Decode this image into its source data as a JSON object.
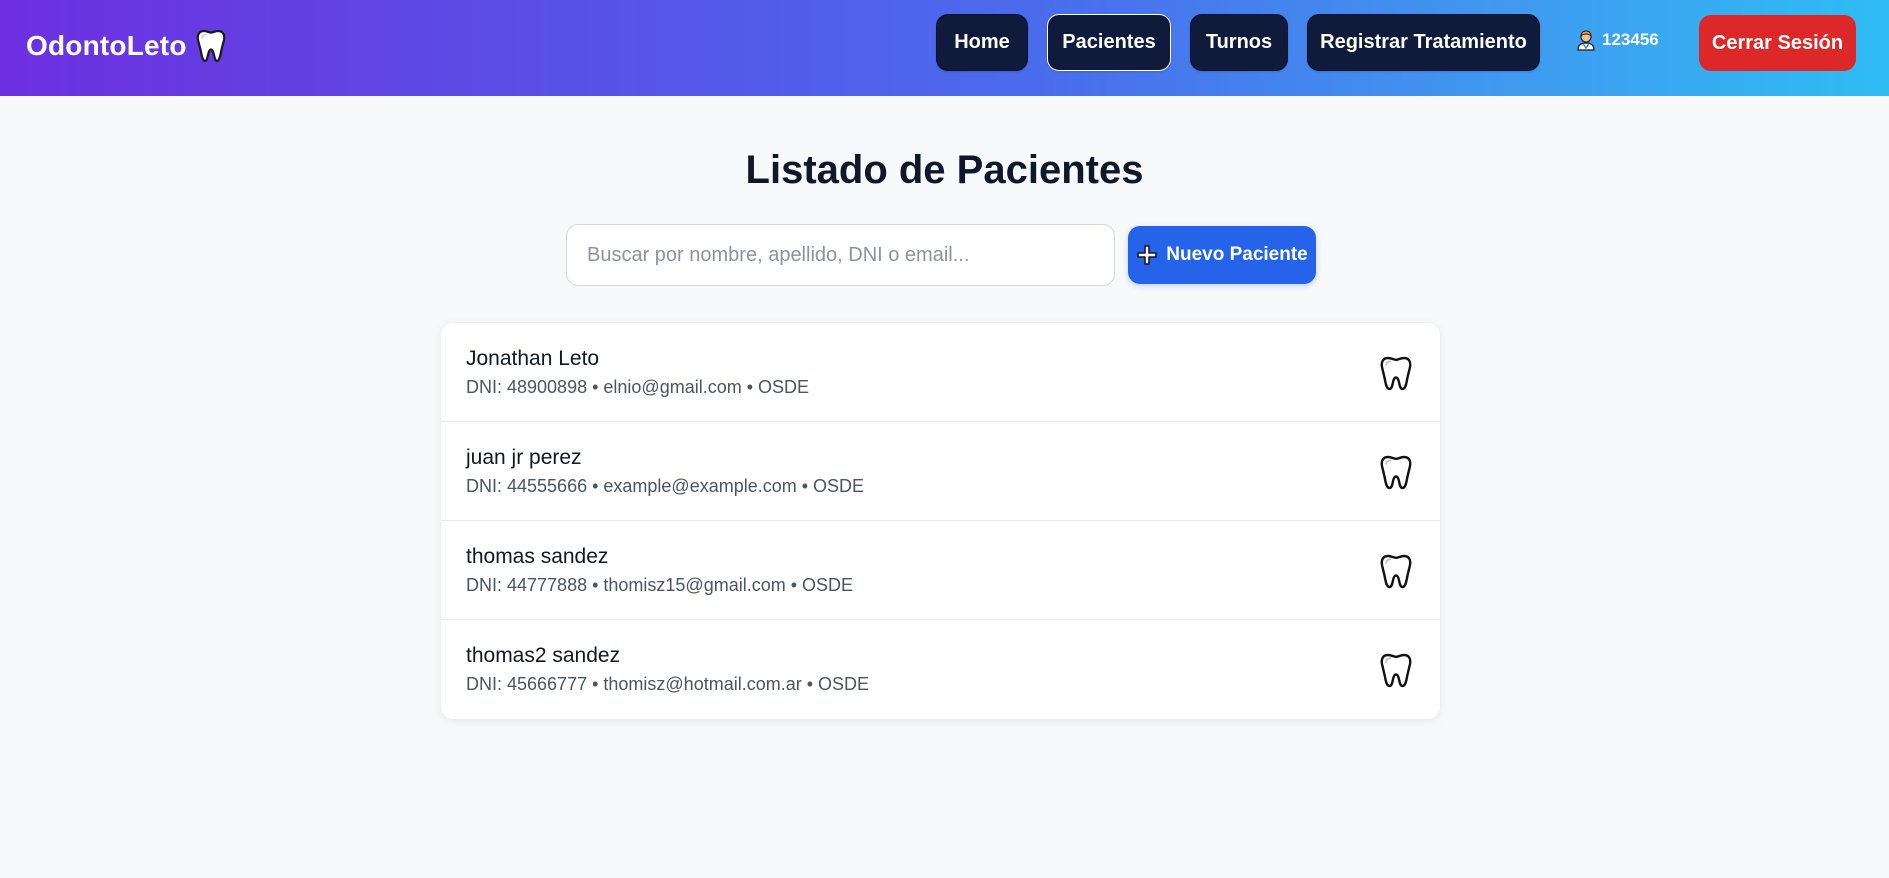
{
  "navbar": {
    "brand": "OdontoLeto",
    "brand_icon": "tooth-icon",
    "links": [
      {
        "label": "Home",
        "active": false
      },
      {
        "label": "Pacientes",
        "active": true
      },
      {
        "label": "Turnos",
        "active": false
      },
      {
        "label": "Registrar Tratamiento",
        "active": false
      }
    ],
    "user_icon": "doctor-icon",
    "user_id": "123456",
    "logout_label": "Cerrar Sesión",
    "colors": {
      "gradient_start": "#6d2fe0",
      "gradient_end": "#2fbdf4",
      "nav_button": "#101a3a",
      "logout": "#dc2828"
    }
  },
  "main": {
    "title": "Listado de Pacientes",
    "search": {
      "placeholder": "Buscar por nombre, apellido, DNI o email...",
      "value": ""
    },
    "new_button": {
      "label": "Nuevo Paciente",
      "icon": "plus-icon",
      "color": "#2563eb"
    },
    "patients": [
      {
        "name": "Jonathan Leto",
        "meta": "DNI: 48900898 • elnio@gmail.com • OSDE",
        "icon": "tooth-icon"
      },
      {
        "name": "juan jr perez",
        "meta": "DNI: 44555666 • example@example.com • OSDE",
        "icon": "tooth-icon"
      },
      {
        "name": "thomas sandez",
        "meta": "DNI: 44777888 • thomisz15@gmail.com • OSDE",
        "icon": "tooth-icon"
      },
      {
        "name": "thomas2 sandez",
        "meta": "DNI: 45666777 • thomisz@hotmail.com.ar • OSDE",
        "icon": "tooth-icon"
      }
    ]
  }
}
